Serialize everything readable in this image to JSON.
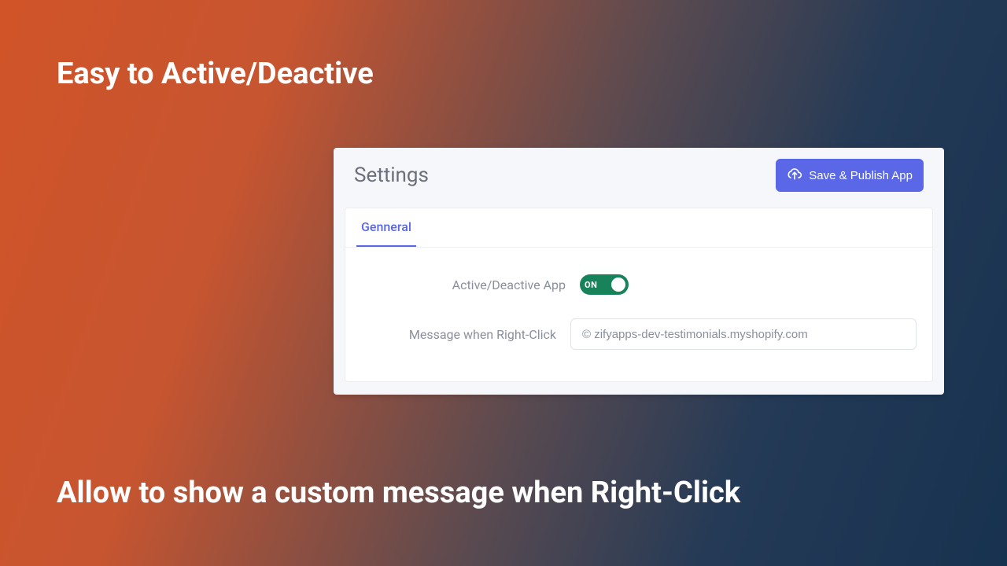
{
  "headline_top": "Easy to Active/Deactive",
  "headline_bottom": "Allow to show a custom message when Right-Click",
  "panel": {
    "title": "Settings",
    "save_button": "Save & Publish App",
    "tab_label": "Genneral",
    "rows": {
      "active": {
        "label": "Active/Deactive App",
        "toggle_text": "ON"
      },
      "message": {
        "label": "Message when Right-Click",
        "value": "© zifyapps-dev-testimonials.myshopify.com"
      }
    }
  }
}
